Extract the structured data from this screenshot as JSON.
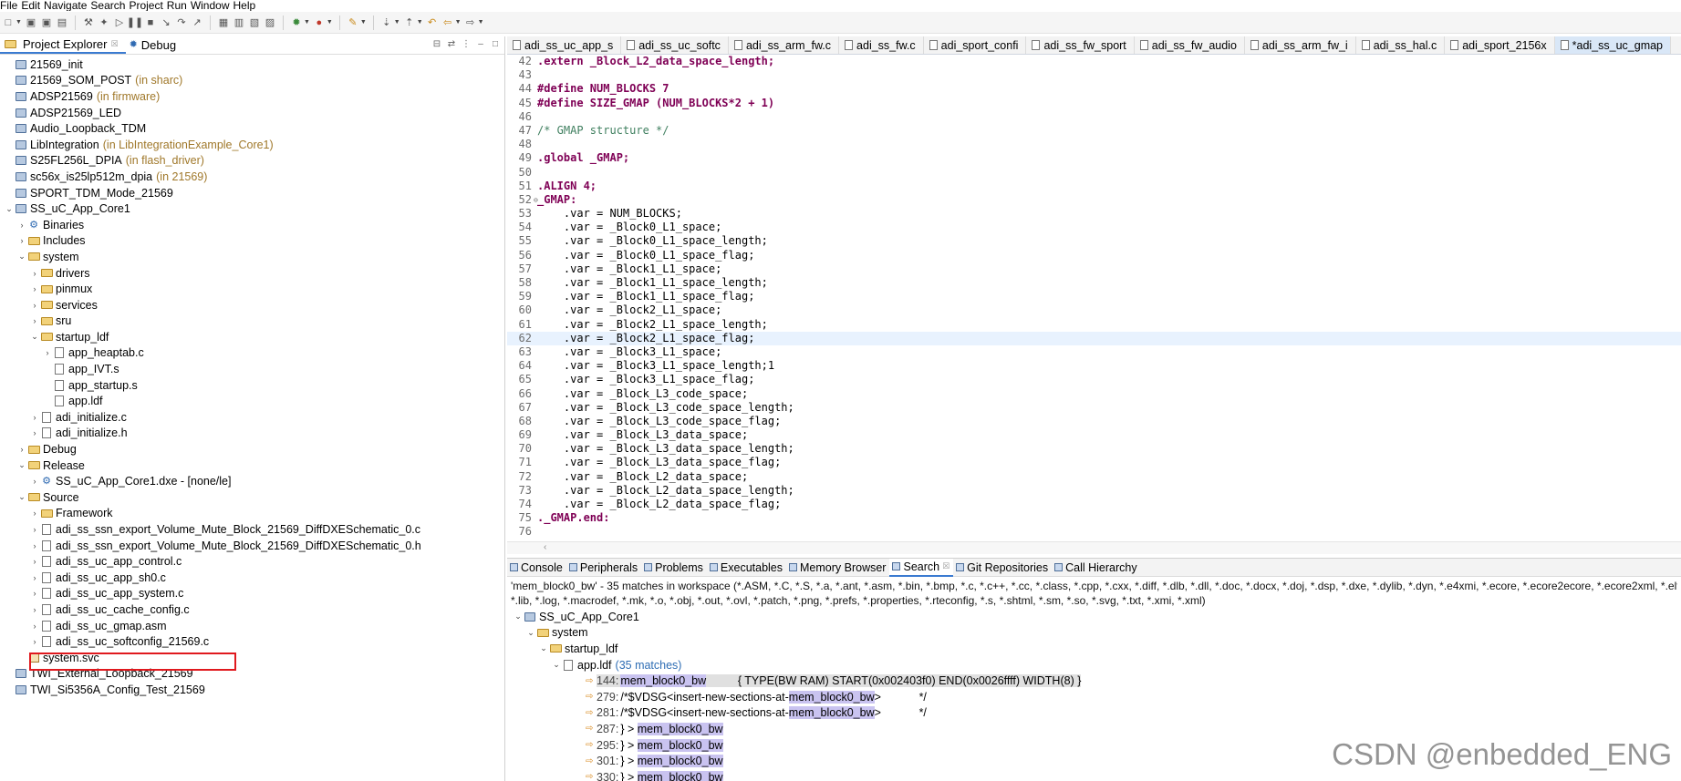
{
  "menu": [
    "File",
    "Edit",
    "Navigate",
    "Search",
    "Project",
    "Run",
    "Window",
    "Help"
  ],
  "left_tabs": [
    {
      "label": "Project Explorer",
      "close": "☒",
      "active": true
    },
    {
      "label": "Debug",
      "active": false
    }
  ],
  "tree": [
    {
      "depth": 0,
      "twisty": "",
      "icon": "project",
      "label": "21569_init",
      "suffix": ""
    },
    {
      "depth": 0,
      "twisty": "",
      "icon": "project",
      "label": "21569_SOM_POST",
      "suffix": "(in sharc)"
    },
    {
      "depth": 0,
      "twisty": "",
      "icon": "project",
      "label": "ADSP21569",
      "suffix": "(in firmware)"
    },
    {
      "depth": 0,
      "twisty": "",
      "icon": "project",
      "label": "ADSP21569_LED",
      "suffix": ""
    },
    {
      "depth": 0,
      "twisty": "",
      "icon": "project",
      "label": "Audio_Loopback_TDM",
      "suffix": ""
    },
    {
      "depth": 0,
      "twisty": "",
      "icon": "project",
      "label": "LibIntegration",
      "suffix": "(in LibIntegrationExample_Core1)"
    },
    {
      "depth": 0,
      "twisty": "",
      "icon": "project",
      "label": "S25FL256L_DPIA",
      "suffix": "(in flash_driver)"
    },
    {
      "depth": 0,
      "twisty": "",
      "icon": "project",
      "label": "sc56x_is25lp512m_dpia",
      "suffix": "(in 21569)"
    },
    {
      "depth": 0,
      "twisty": "",
      "icon": "project",
      "label": "SPORT_TDM_Mode_21569",
      "suffix": ""
    },
    {
      "depth": 0,
      "twisty": "v",
      "icon": "project",
      "label": "SS_uC_App_Core1",
      "suffix": ""
    },
    {
      "depth": 1,
      "twisty": ">",
      "icon": "gear",
      "label": "Binaries",
      "suffix": ""
    },
    {
      "depth": 1,
      "twisty": ">",
      "icon": "folder",
      "label": "Includes",
      "suffix": ""
    },
    {
      "depth": 1,
      "twisty": "v",
      "icon": "folder",
      "label": "system",
      "suffix": ""
    },
    {
      "depth": 2,
      "twisty": ">",
      "icon": "folder",
      "label": "drivers",
      "suffix": ""
    },
    {
      "depth": 2,
      "twisty": ">",
      "icon": "folder",
      "label": "pinmux",
      "suffix": ""
    },
    {
      "depth": 2,
      "twisty": ">",
      "icon": "folder",
      "label": "services",
      "suffix": ""
    },
    {
      "depth": 2,
      "twisty": ">",
      "icon": "folder",
      "label": "sru",
      "suffix": ""
    },
    {
      "depth": 2,
      "twisty": "v",
      "icon": "folder",
      "label": "startup_ldf",
      "suffix": ""
    },
    {
      "depth": 3,
      "twisty": ">",
      "icon": "file",
      "label": "app_heaptab.c",
      "suffix": ""
    },
    {
      "depth": 3,
      "twisty": "",
      "icon": "file",
      "label": "app_IVT.s",
      "suffix": ""
    },
    {
      "depth": 3,
      "twisty": "",
      "icon": "file",
      "label": "app_startup.s",
      "suffix": ""
    },
    {
      "depth": 3,
      "twisty": "",
      "icon": "file",
      "label": "app.ldf",
      "suffix": ""
    },
    {
      "depth": 2,
      "twisty": ">",
      "icon": "file",
      "label": "adi_initialize.c",
      "suffix": ""
    },
    {
      "depth": 2,
      "twisty": ">",
      "icon": "file",
      "label": "adi_initialize.h",
      "suffix": ""
    },
    {
      "depth": 1,
      "twisty": ">",
      "icon": "folder",
      "label": "Debug",
      "suffix": ""
    },
    {
      "depth": 1,
      "twisty": "v",
      "icon": "folder",
      "label": "Release",
      "suffix": ""
    },
    {
      "depth": 2,
      "twisty": ">",
      "icon": "gear",
      "label": "SS_uC_App_Core1.dxe - [none/le]",
      "suffix": ""
    },
    {
      "depth": 1,
      "twisty": "v",
      "icon": "folder",
      "label": "Source",
      "suffix": ""
    },
    {
      "depth": 2,
      "twisty": ">",
      "icon": "folder",
      "label": "Framework",
      "suffix": ""
    },
    {
      "depth": 2,
      "twisty": ">",
      "icon": "file",
      "label": "adi_ss_ssn_export_Volume_Mute_Block_21569_DiffDXESchematic_0.c",
      "suffix": ""
    },
    {
      "depth": 2,
      "twisty": ">",
      "icon": "file",
      "label": "adi_ss_ssn_export_Volume_Mute_Block_21569_DiffDXESchematic_0.h",
      "suffix": ""
    },
    {
      "depth": 2,
      "twisty": ">",
      "icon": "file",
      "label": "adi_ss_uc_app_control.c",
      "suffix": ""
    },
    {
      "depth": 2,
      "twisty": ">",
      "icon": "file",
      "label": "adi_ss_uc_app_sh0.c",
      "suffix": ""
    },
    {
      "depth": 2,
      "twisty": ">",
      "icon": "file",
      "label": "adi_ss_uc_app_system.c",
      "suffix": ""
    },
    {
      "depth": 2,
      "twisty": ">",
      "icon": "file",
      "label": "adi_ss_uc_cache_config.c",
      "suffix": ""
    },
    {
      "depth": 2,
      "twisty": ">",
      "icon": "file",
      "label": "adi_ss_uc_gmap.asm",
      "suffix": ""
    },
    {
      "depth": 2,
      "twisty": ">",
      "icon": "file",
      "label": "adi_ss_uc_softconfig_21569.c",
      "suffix": ""
    },
    {
      "depth": 1,
      "twisty": "",
      "icon": "svc",
      "label": "system.svc",
      "suffix": ""
    },
    {
      "depth": 0,
      "twisty": "",
      "icon": "project",
      "label": "TWI_External_Loopback_21569",
      "suffix": ""
    },
    {
      "depth": 0,
      "twisty": "",
      "icon": "project",
      "label": "TWI_Si5356A_Config_Test_21569",
      "suffix": ""
    }
  ],
  "editor_tabs": [
    {
      "label": "adi_ss_uc_app_s",
      "active": false
    },
    {
      "label": "adi_ss_uc_softc",
      "active": false
    },
    {
      "label": "adi_ss_arm_fw.c",
      "active": false
    },
    {
      "label": "adi_ss_fw.c",
      "active": false
    },
    {
      "label": "adi_sport_confi",
      "active": false
    },
    {
      "label": "adi_ss_fw_sport",
      "active": false
    },
    {
      "label": "adi_ss_fw_audio",
      "active": false
    },
    {
      "label": "adi_ss_arm_fw_i",
      "active": false
    },
    {
      "label": "adi_ss_hal.c",
      "active": false
    },
    {
      "label": "adi_sport_2156x",
      "active": false
    },
    {
      "label": "*adi_ss_uc_gmap",
      "active": true
    }
  ],
  "code_lines": [
    {
      "n": "42",
      "text": ".extern _Block_L2_data_space_length;"
    },
    {
      "n": "43",
      "text": ""
    },
    {
      "n": "44",
      "text": "#define NUM_BLOCKS 7"
    },
    {
      "n": "45",
      "text": "#define SIZE_GMAP (NUM_BLOCKS*2 + 1)"
    },
    {
      "n": "46",
      "text": ""
    },
    {
      "n": "47",
      "text": "/* GMAP structure */"
    },
    {
      "n": "48",
      "text": ""
    },
    {
      "n": "49",
      "text": ".global _GMAP;"
    },
    {
      "n": "50",
      "text": ""
    },
    {
      "n": "51",
      "text": ".ALIGN 4;"
    },
    {
      "n": "52",
      "text": "_GMAP:"
    },
    {
      "n": "53",
      "text": "    .var = NUM_BLOCKS;"
    },
    {
      "n": "54",
      "text": "    .var = _Block0_L1_space;"
    },
    {
      "n": "55",
      "text": "    .var = _Block0_L1_space_length;"
    },
    {
      "n": "56",
      "text": "    .var = _Block0_L1_space_flag;"
    },
    {
      "n": "57",
      "text": "    .var = _Block1_L1_space;"
    },
    {
      "n": "58",
      "text": "    .var = _Block1_L1_space_length;"
    },
    {
      "n": "59",
      "text": "    .var = _Block1_L1_space_flag;"
    },
    {
      "n": "60",
      "text": "    .var = _Block2_L1_space;"
    },
    {
      "n": "61",
      "text": "    .var = _Block2_L1_space_length;"
    },
    {
      "n": "62",
      "text": "    .var = _Block2_L1_space_flag;"
    },
    {
      "n": "63",
      "text": "    .var = _Block3_L1_space;"
    },
    {
      "n": "64",
      "text": "    .var = _Block3_L1_space_length;1"
    },
    {
      "n": "65",
      "text": "    .var = _Block3_L1_space_flag;"
    },
    {
      "n": "66",
      "text": "    .var = _Block_L3_code_space;"
    },
    {
      "n": "67",
      "text": "    .var = _Block_L3_code_space_length;"
    },
    {
      "n": "68",
      "text": "    .var = _Block_L3_code_space_flag;"
    },
    {
      "n": "69",
      "text": "    .var = _Block_L3_data_space;"
    },
    {
      "n": "70",
      "text": "    .var = _Block_L3_data_space_length;"
    },
    {
      "n": "71",
      "text": "    .var = _Block_L3_data_space_flag;"
    },
    {
      "n": "72",
      "text": "    .var = _Block_L2_data_space;"
    },
    {
      "n": "73",
      "text": "    .var = _Block_L2_data_space_length;"
    },
    {
      "n": "74",
      "text": "    .var = _Block_L2_data_space_flag;"
    },
    {
      "n": "75",
      "text": "._GMAP.end:"
    },
    {
      "n": "76",
      "text": ""
    }
  ],
  "current_line": "62",
  "bottom_tabs": [
    {
      "label": "Console",
      "active": false
    },
    {
      "label": "Peripherals",
      "active": false
    },
    {
      "label": "Problems",
      "active": false
    },
    {
      "label": "Executables",
      "active": false
    },
    {
      "label": "Memory Browser",
      "active": false
    },
    {
      "label": "Search",
      "active": true
    },
    {
      "label": "Git Repositories",
      "active": false
    },
    {
      "label": "Call Hierarchy",
      "active": false
    }
  ],
  "search": {
    "summary": "'mem_block0_bw' - 35 matches in workspace (*.ASM, *.C, *.S, *.a, *.ant, *.asm, *.bin, *.bmp, *.c, *.c++, *.cc, *.class, *.cpp, *.cxx, *.diff, *.dlb, *.dll, *.doc, *.docx, *.doj, *.dsp, *.dxe, *.dylib, *.dyn, *.e4xmi, *.ecore, *.ecore2ecore, *.ecore2xml, *.elf, *.e",
    "summary2": "*.lib, *.log, *.macrodef, *.mk, *.o, *.obj, *.out, *.ovl, *.patch, *.png, *.prefs, *.properties, *.rteconfig, *.s, *.shtml, *.sm, *.so, *.svg, *.txt, *.xmi, *.xml)",
    "tree": [
      {
        "depth": 0,
        "label": "SS_uC_App_Core1"
      },
      {
        "depth": 1,
        "label": "system"
      },
      {
        "depth": 2,
        "label": "startup_ldf"
      },
      {
        "depth": 3,
        "label": "app.ldf",
        "count": "(35 matches)"
      }
    ],
    "matches": [
      {
        "line": "144:",
        "before": "",
        "hit": "mem_block0_bw",
        "after": "          { TYPE(BW RAM) START(0x002403f0) END(0x0026ffff) WIDTH(8) }",
        "selected": true
      },
      {
        "line": "279:",
        "before": "/*$VDSG<insert-new-sections-at-",
        "hit": "mem_block0_bw",
        "after": ">            */",
        "selected": false
      },
      {
        "line": "281:",
        "before": "/*$VDSG<insert-new-sections-at-",
        "hit": "mem_block0_bw",
        "after": ">            */",
        "selected": false
      },
      {
        "line": "287:",
        "before": "} > ",
        "hit": "mem_block0_bw",
        "after": "",
        "selected": false
      },
      {
        "line": "295:",
        "before": "} > ",
        "hit": "mem_block0_bw",
        "after": "",
        "selected": false
      },
      {
        "line": "301:",
        "before": "} > ",
        "hit": "mem_block0_bw",
        "after": "",
        "selected": false
      },
      {
        "line": "330:",
        "before": "} > ",
        "hit": "mem_block0_bw",
        "after": "",
        "selected": false
      }
    ]
  },
  "watermark": "CSDN @enbedded_ENG",
  "colors": {
    "highlight": "#e0191e",
    "active_tab": "#3b7bd1",
    "match_bg": "#c9c3f0"
  }
}
